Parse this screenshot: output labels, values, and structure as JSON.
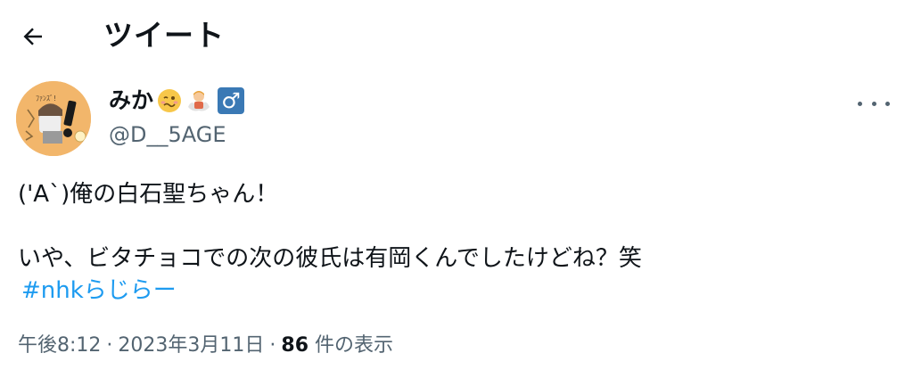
{
  "header": {
    "title": "ツイート",
    "back_icon": "arrow-left-icon"
  },
  "user": {
    "name": "みか",
    "handle": "@D__5AGE",
    "avatar_text": "ﾌｧﾝｽﾞ!",
    "badges": [
      "woozy-face-emoji",
      "person-in-steamy-room-emoji",
      "male-sign-emoji"
    ],
    "male_symbol": "♂",
    "badge_color": "#3a79b5"
  },
  "tweet": {
    "line1": "('A`)俺の白石聖ちゃん！",
    "line2": "いや、ビタチョコでの次の彼氏は有岡くんでしたけどね？笑",
    "hashtag": "#nhkらじらー",
    "hashtag_color": "#1d9bf0"
  },
  "meta": {
    "time": "午後8:12",
    "date": "2023年3月11日",
    "views_count": "86",
    "views_label": "件の表示"
  },
  "menu": {
    "more_icon": "more-horizontal-icon"
  }
}
